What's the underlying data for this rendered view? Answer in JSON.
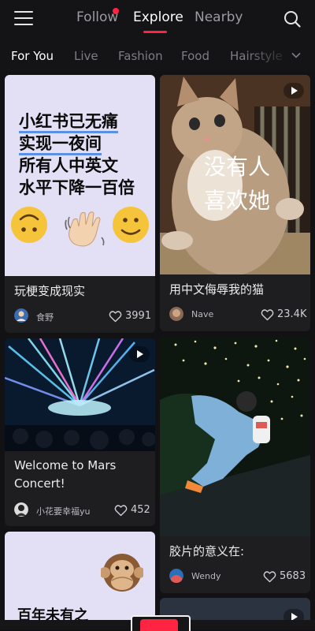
{
  "header": {
    "tabs": [
      {
        "label": "Follow",
        "has_dot": true
      },
      {
        "label": "Explore",
        "active": true
      },
      {
        "label": "Nearby"
      }
    ],
    "icons": [
      "menu-icon",
      "search-icon"
    ]
  },
  "categories": {
    "items": [
      "For You",
      "Live",
      "Fashion",
      "Food",
      "Hairstyle"
    ],
    "active": "For You"
  },
  "feed": {
    "cards": [
      {
        "meme_lines": [
          "小红书已无痛",
          "实现一夜间",
          "所有人中英文",
          "水平下降一百倍"
        ],
        "title": "玩梗变成现实",
        "author": "食野",
        "likes": "3991"
      },
      {
        "overlay_lines": [
          "没有人",
          "喜欢她"
        ],
        "title": "用中文侮辱我的猫",
        "author": "Nave",
        "likes": "23.4K",
        "is_video": true
      },
      {
        "title_lines": [
          "Welcome to Mars",
          "Concert!"
        ],
        "author": "小花要幸福yu",
        "likes": "452",
        "is_video": true
      },
      {
        "title": "胶片的意义在:",
        "author": "Wendy",
        "likes": "5683"
      },
      {
        "title_partial": "百年未有之"
      }
    ]
  },
  "colors": {
    "accent": "#ff2442",
    "background": "#121214",
    "card": "#1e1e21",
    "meme_bg": "#e3dff5"
  }
}
